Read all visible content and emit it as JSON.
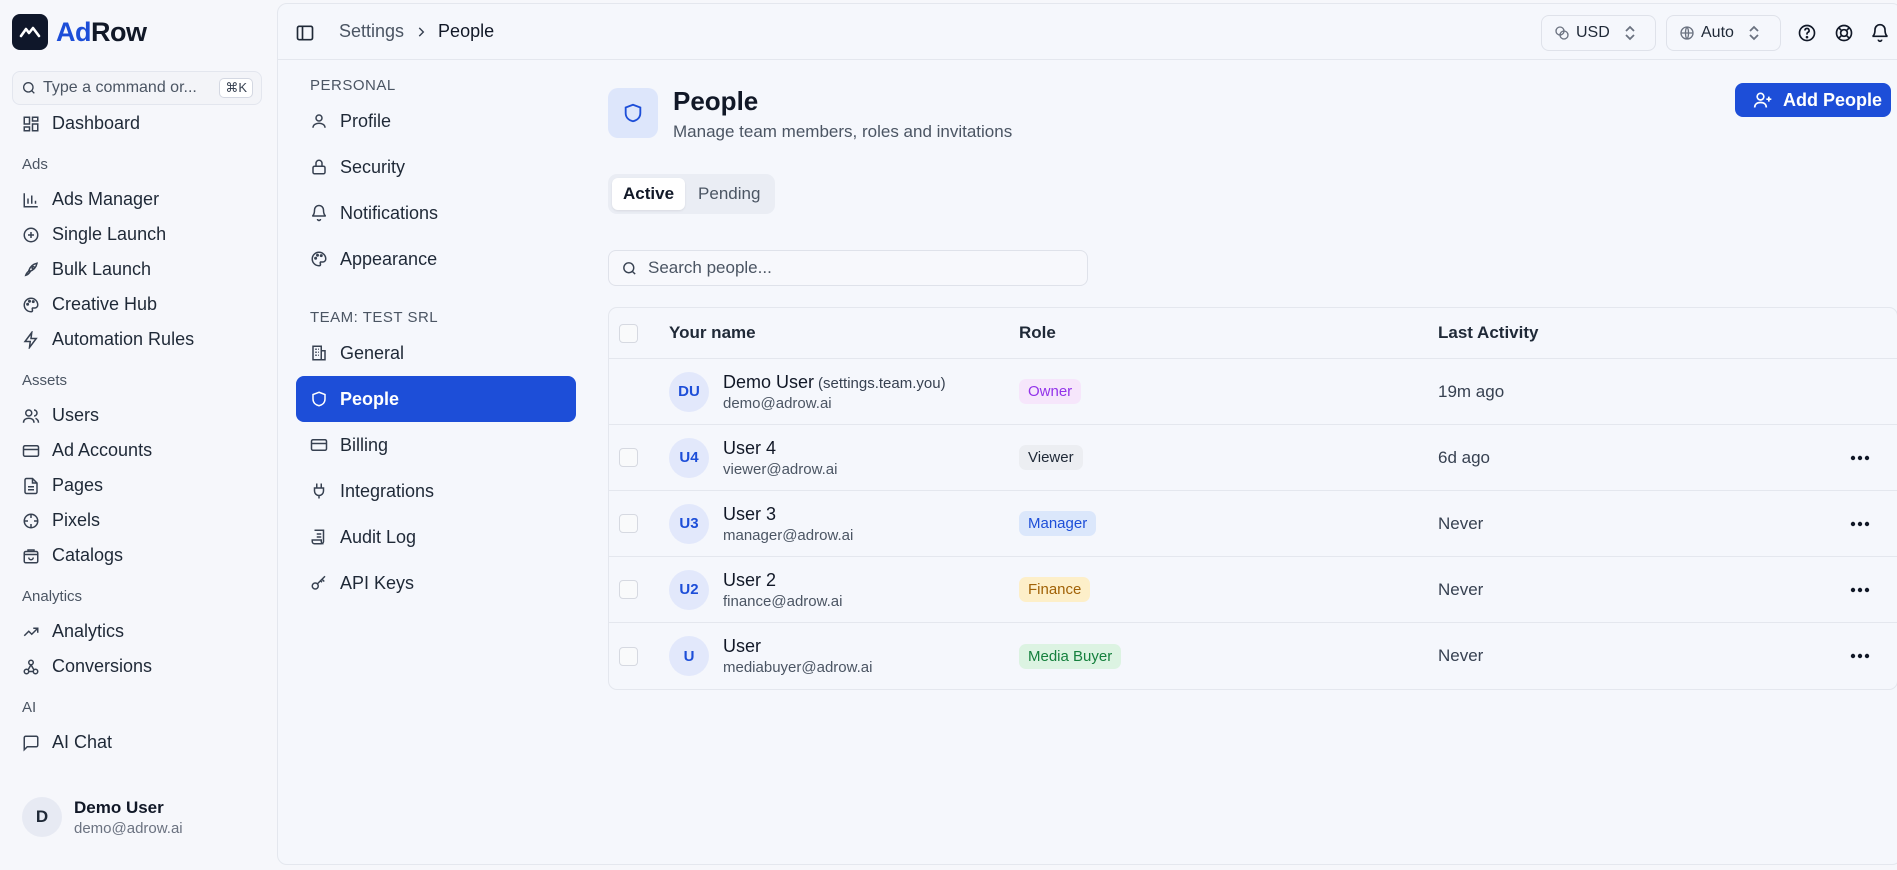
{
  "brand": {
    "name_part1": "Ad",
    "name_part2": "Row"
  },
  "command": {
    "placeholder": "Type a command or...",
    "shortcut": "⌘K"
  },
  "sidebar": {
    "dashboard": "Dashboard",
    "sections": {
      "ads": "Ads",
      "assets": "Assets",
      "analytics": "Analytics",
      "ai": "AI"
    },
    "ads_items": [
      "Ads Manager",
      "Single Launch",
      "Bulk Launch",
      "Creative Hub",
      "Automation Rules"
    ],
    "assets_items": [
      "Users",
      "Ad Accounts",
      "Pages",
      "Pixels",
      "Catalogs"
    ],
    "analytics_items": [
      "Analytics",
      "Conversions"
    ],
    "ai_items": [
      "AI Chat"
    ],
    "user": {
      "initial": "D",
      "name": "Demo User",
      "email": "demo@adrow.ai"
    }
  },
  "topbar": {
    "breadcrumb": [
      "Settings",
      "People"
    ],
    "currency": "USD",
    "language": "Auto"
  },
  "settings_nav": {
    "personal_label": "PERSONAL",
    "personal": [
      "Profile",
      "Security",
      "Notifications",
      "Appearance"
    ],
    "team_label": "TEAM: TEST SRL",
    "team": [
      "General",
      "People",
      "Billing",
      "Integrations",
      "Audit Log",
      "API Keys"
    ],
    "active": "People"
  },
  "page": {
    "title": "People",
    "subtitle": "Manage team members, roles and invitations",
    "add_button": "Add People",
    "tabs": [
      "Active",
      "Pending"
    ],
    "active_tab": "Active",
    "search_placeholder": "Search people..."
  },
  "table": {
    "columns": [
      "Your name",
      "Role",
      "Last Activity"
    ],
    "rows": [
      {
        "initials": "DU",
        "name": "Demo User",
        "tag": "(settings.team.you)",
        "email": "demo@adrow.ai",
        "role": "Owner",
        "role_bg": "#f6e6fb",
        "role_fg": "#9333ea",
        "last": "19m ago",
        "selectable": false
      },
      {
        "initials": "U4",
        "name": "User 4",
        "tag": "",
        "email": "viewer@adrow.ai",
        "role": "Viewer",
        "role_bg": "#eceef2",
        "role_fg": "#1f2937",
        "last": "6d ago",
        "selectable": true
      },
      {
        "initials": "U3",
        "name": "User 3",
        "tag": "",
        "email": "manager@adrow.ai",
        "role": "Manager",
        "role_bg": "#dbe7fb",
        "role_fg": "#1d4ed8",
        "last": "Never",
        "selectable": true
      },
      {
        "initials": "U2",
        "name": "User 2",
        "tag": "",
        "email": "finance@adrow.ai",
        "role": "Finance",
        "role_bg": "#fdefc9",
        "role_fg": "#a16207",
        "last": "Never",
        "selectable": true
      },
      {
        "initials": "U",
        "name": "User",
        "tag": "",
        "email": "mediabuyer@adrow.ai",
        "role": "Media Buyer",
        "role_bg": "#dcf3e2",
        "role_fg": "#15803d",
        "last": "Never",
        "selectable": true
      }
    ]
  },
  "colors": {
    "accent": "#1d4ed8",
    "brand_dark": "#0f172a"
  }
}
